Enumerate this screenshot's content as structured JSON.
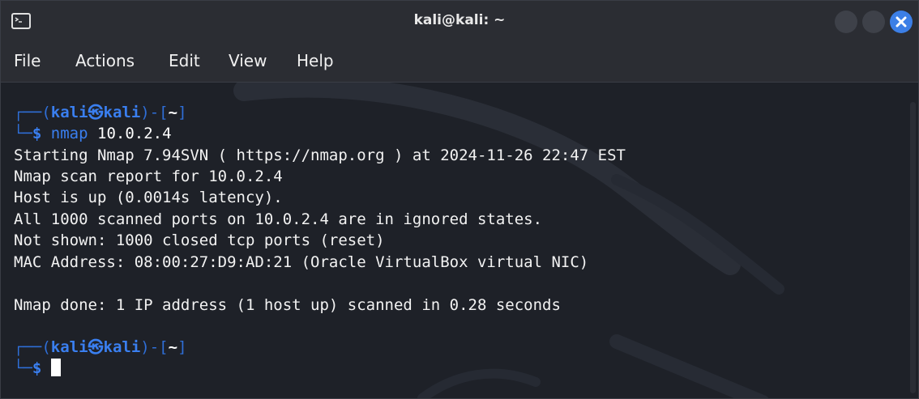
{
  "window": {
    "title": "kali@kali: ~",
    "accent_color": "#3c7fe6",
    "close_icon": "close-icon"
  },
  "menu": {
    "items": [
      "File",
      "Actions",
      "Edit",
      "View",
      "Help"
    ]
  },
  "terminal": {
    "prompt1": {
      "frame_top": "┌──(",
      "user_host": "kali㉿kali",
      "close_bracket": ")-[",
      "dir": "~",
      "end_bracket": "]",
      "frame_bottom": "└─",
      "dollar": "$",
      "command": "nmap",
      "argument": "10.0.2.4"
    },
    "output": [
      "Starting Nmap 7.94SVN ( https://nmap.org ) at 2024-11-26 22:47 EST",
      "Nmap scan report for 10.0.2.4",
      "Host is up (0.0014s latency).",
      "All 1000 scanned ports on 10.0.2.4 are in ignored states.",
      "Not shown: 1000 closed tcp ports (reset)",
      "MAC Address: 08:00:27:D9:AD:21 (Oracle VirtualBox virtual NIC)",
      "",
      "Nmap done: 1 IP address (1 host up) scanned in 0.28 seconds"
    ],
    "prompt2": {
      "frame_top": "┌──(",
      "user_host": "kali㉿kali",
      "close_bracket": ")-[",
      "dir": "~",
      "end_bracket": "]",
      "frame_bottom": "└─",
      "dollar": "$"
    }
  }
}
